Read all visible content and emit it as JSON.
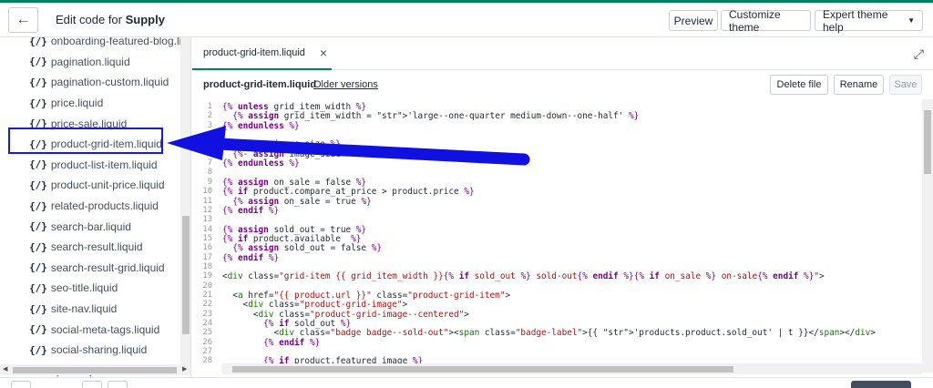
{
  "header": {
    "title_prefix": "Edit code for ",
    "title_store": "Supply",
    "preview_label": "Preview",
    "customize_label": "Customize theme",
    "expert_label": "Expert theme help",
    "back_icon": "arrow-left-icon",
    "accent_color": "#008060"
  },
  "sidebar": {
    "items": [
      {
        "label": "onboarding-featured-blog.liquid"
      },
      {
        "label": "pagination.liquid"
      },
      {
        "label": "pagination-custom.liquid"
      },
      {
        "label": "price.liquid"
      },
      {
        "label": "price-sale.liquid"
      },
      {
        "label": "product-grid-item.liquid"
      },
      {
        "label": "product-list-item.liquid"
      },
      {
        "label": "product-unit-price.liquid"
      },
      {
        "label": "related-products.liquid"
      },
      {
        "label": "search-bar.liquid"
      },
      {
        "label": "search-result.liquid"
      },
      {
        "label": "search-result-grid.liquid"
      },
      {
        "label": "seo-title.liquid"
      },
      {
        "label": "site-nav.liquid"
      },
      {
        "label": "social-meta-tags.liquid"
      },
      {
        "label": "social-sharing.liquid"
      },
      {
        "label": "sprite.liquid"
      }
    ],
    "file_icon_text": "{/}",
    "highlight_color": "#1b1bd0"
  },
  "editor": {
    "tab_label": "product-grid-item.liquid",
    "file_name": "product-grid-item.liquid",
    "older_versions": "Older versions",
    "delete_label": "Delete file",
    "rename_label": "Rename",
    "save_label": "Save",
    "lines": [
      {
        "n": "1",
        "text": "{% unless grid_item_width %}"
      },
      {
        "n": "2",
        "text": "  {% assign grid_item_width = 'large--one-quarter medium-down--one-half' %}"
      },
      {
        "n": "3",
        "text": "{% endunless %}"
      },
      {
        "n": "4",
        "text": ""
      },
      {
        "n": "5",
        "text": "{% unless image_size %}"
      },
      {
        "n": "6",
        "text": "  {%- assign image_size = '600x600' -%}"
      },
      {
        "n": "7",
        "text": "{% endunless %}"
      },
      {
        "n": "8",
        "text": ""
      },
      {
        "n": "9",
        "text": "{% assign on_sale = false %}"
      },
      {
        "n": "10",
        "text": "{% if product.compare_at_price > product.price %}"
      },
      {
        "n": "11",
        "text": "  {% assign on_sale = true %}"
      },
      {
        "n": "12",
        "text": "{% endif %}"
      },
      {
        "n": "13",
        "text": ""
      },
      {
        "n": "14",
        "text": "{% assign sold_out = true %}"
      },
      {
        "n": "15",
        "text": "{% if product.available  %}"
      },
      {
        "n": "16",
        "text": "  {% assign sold_out = false %}"
      },
      {
        "n": "17",
        "text": "{% endif %}"
      },
      {
        "n": "18",
        "text": ""
      },
      {
        "n": "19",
        "text": "<div class=\"grid-item {{ grid_item_width }}{% if sold_out %} sold-out{% endif %}{% if on_sale %} on-sale{% endif %}\">"
      },
      {
        "n": "20",
        "text": ""
      },
      {
        "n": "21",
        "text": "  <a href=\"{{ product.url }}\" class=\"product-grid-item\">"
      },
      {
        "n": "22",
        "text": "    <div class=\"product-grid-image\">"
      },
      {
        "n": "23",
        "text": "      <div class=\"product-grid-image--centered\">"
      },
      {
        "n": "24",
        "text": "        {% if sold_out %}"
      },
      {
        "n": "25",
        "text": "          <div class=\"badge badge--sold-out\"><span class=\"badge-label\">{{ 'products.product.sold_out' | t }}</span></div>"
      },
      {
        "n": "26",
        "text": "        {% endif %}"
      },
      {
        "n": "27",
        "text": ""
      },
      {
        "n": "28",
        "text": "        {% if product.featured_image %}"
      }
    ]
  }
}
